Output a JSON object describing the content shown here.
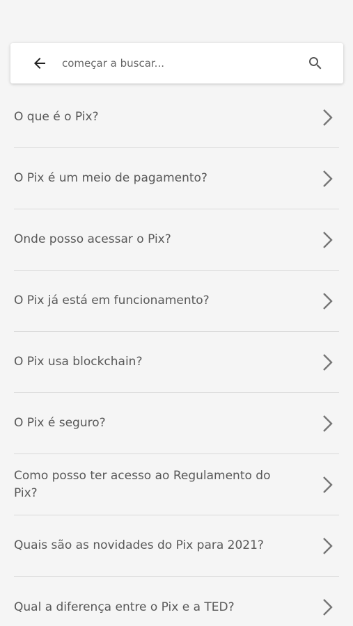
{
  "search": {
    "placeholder": "começar a buscar..."
  },
  "icons": {
    "back": "arrow-left-icon",
    "search": "magnifier-icon",
    "item": "chevron-right-icon"
  },
  "colors": {
    "background": "#f5f5f5",
    "text": "#585858",
    "divider": "#d9d9d9",
    "icon": "#757575"
  },
  "faq": {
    "items": [
      {
        "label": "O que é o Pix?"
      },
      {
        "label": "O Pix é um meio de pagamento?"
      },
      {
        "label": "Onde posso acessar o Pix?"
      },
      {
        "label": "O Pix já está em funcionamento?"
      },
      {
        "label": "O Pix usa blockchain?"
      },
      {
        "label": "O Pix é seguro?"
      },
      {
        "label": "Como posso ter acesso ao Regulamento do Pix?"
      },
      {
        "label": "Quais são as novidades do Pix para 2021?"
      },
      {
        "label": "Qual a diferença entre o Pix e a TED?"
      }
    ]
  }
}
